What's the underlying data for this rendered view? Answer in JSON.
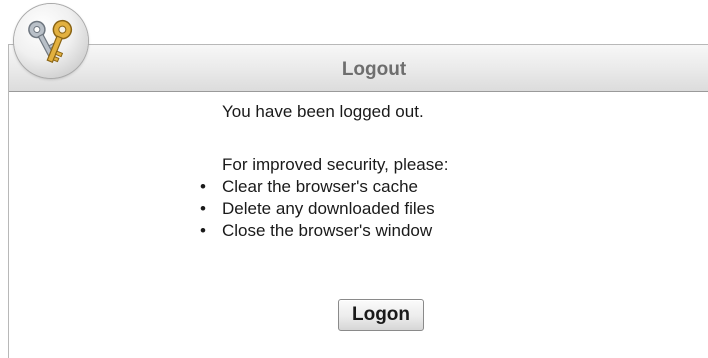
{
  "dialog": {
    "title": "Logout",
    "badge_icon": "keys-icon"
  },
  "message": {
    "logged_out": "You have been logged out.",
    "security_intro": "For improved security, please:",
    "bullet_char": "•",
    "tips": [
      "Clear the browser's cache",
      "Delete any downloaded files",
      "Close the browser's window"
    ]
  },
  "actions": {
    "logon_label": "Logon"
  },
  "colors": {
    "title_text": "#6e6e6e",
    "body_text": "#1a1a1a",
    "key_gold": "#d8a63a",
    "key_silver": "#9aa3ad"
  }
}
